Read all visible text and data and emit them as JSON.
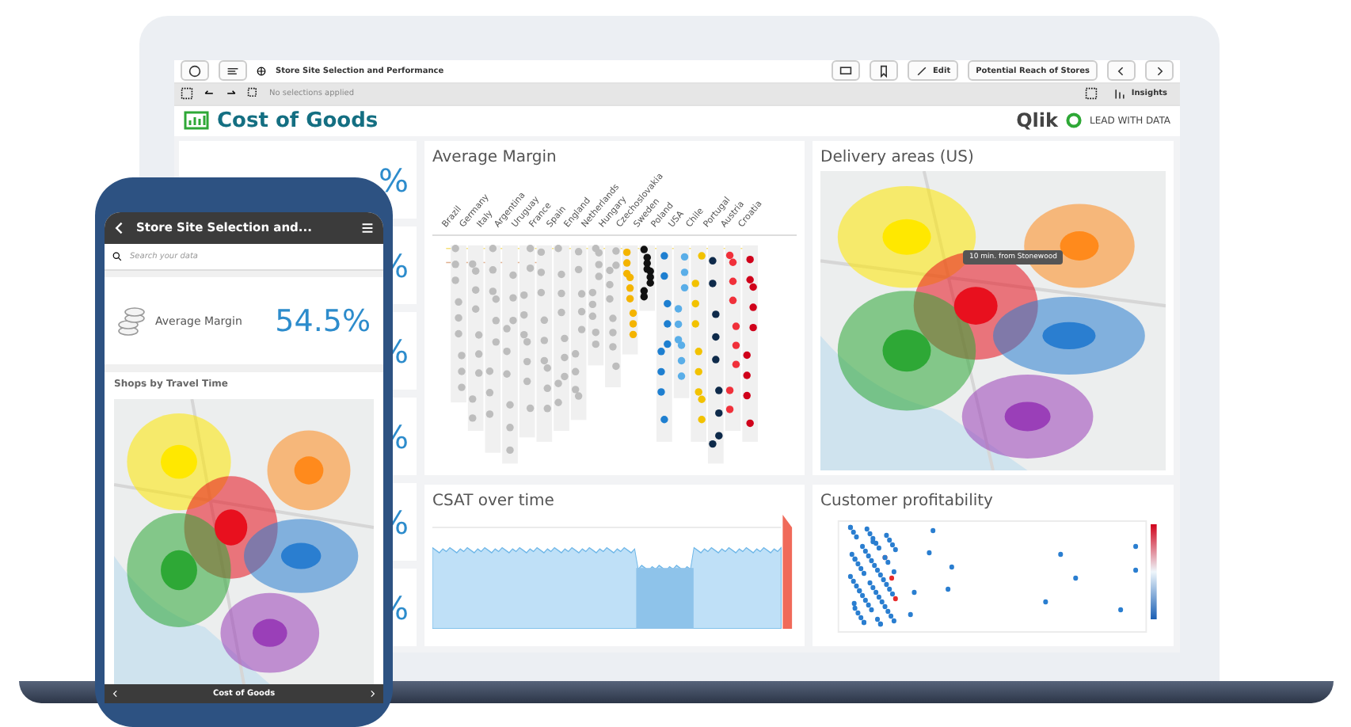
{
  "toolbar": {
    "app_title": "Store Site Selection and Performance",
    "edit_label": "Edit",
    "sheet_select": "Potential Reach of Stores"
  },
  "selection_bar": {
    "status": "No selections applied",
    "insights_label": "Insights"
  },
  "sheet": {
    "title": "Cost of Goods",
    "brand": "Qlik",
    "tagline": "LEAD WITH DATA"
  },
  "kpi_column": [
    {
      "value": "%"
    },
    {
      "value": "%"
    },
    {
      "value": "%"
    },
    {
      "value": "%"
    },
    {
      "value": "%"
    },
    {
      "value": "%"
    }
  ],
  "average_margin": {
    "title": "Average Margin",
    "categories": [
      {
        "label": "Brazil",
        "color": "#bdbdbd"
      },
      {
        "label": "Germany",
        "color": "#bdbdbd"
      },
      {
        "label": "Italy",
        "color": "#bdbdbd"
      },
      {
        "label": "Argentina",
        "color": "#bdbdbd"
      },
      {
        "label": "Uruguay",
        "color": "#bdbdbd"
      },
      {
        "label": "France",
        "color": "#bdbdbd"
      },
      {
        "label": "Spain",
        "color": "#bdbdbd"
      },
      {
        "label": "England",
        "color": "#bdbdbd"
      },
      {
        "label": "Netherlands",
        "color": "#bdbdbd"
      },
      {
        "label": "Hungary",
        "color": "#bdbdbd"
      },
      {
        "label": "Czechoslovakia",
        "color": "#f4b400"
      },
      {
        "label": "Sweden",
        "color": "#111111"
      },
      {
        "label": "Poland",
        "color": "#1e7fd0"
      },
      {
        "label": "USA",
        "color": "#5aaee8"
      },
      {
        "label": "Chile",
        "color": "#f2c200"
      },
      {
        "label": "Portugal",
        "color": "#0e2a4a"
      },
      {
        "label": "Austria",
        "color": "#f0303a"
      },
      {
        "label": "Croatia",
        "color": "#d0021b"
      }
    ]
  },
  "delivery_areas": {
    "title": "Delivery areas (US)",
    "tooltip": "10 min. from Stonewood"
  },
  "csat": {
    "title": "CSAT over time"
  },
  "customer_profitability": {
    "title": "Customer profitability"
  },
  "phone": {
    "title": "Store Site Selection and...",
    "search": {
      "placeholder": "Search your data"
    },
    "kpi": {
      "label": "Average Margin",
      "value": "54.5%"
    },
    "map_title": "Shops by Travel Time",
    "footer": "Cost of Goods"
  }
}
